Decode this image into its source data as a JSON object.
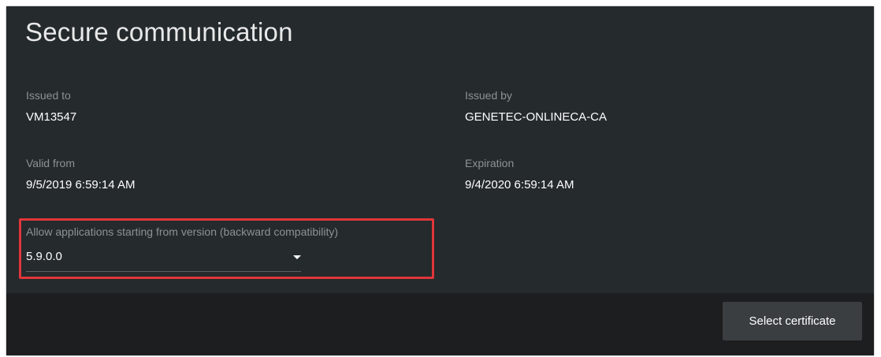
{
  "panel": {
    "title": "Secure communication"
  },
  "fields": {
    "issued_to": {
      "label": "Issued to",
      "value": "VM13547"
    },
    "issued_by": {
      "label": "Issued by",
      "value": "GENETEC-ONLINECA-CA"
    },
    "valid_from": {
      "label": "Valid from",
      "value": "9/5/2019 6:59:14 AM"
    },
    "expiration": {
      "label": "Expiration",
      "value": "9/4/2020 6:59:14 AM"
    }
  },
  "compatibility": {
    "label": "Allow applications starting from version (backward compatibility)",
    "selected": "5.9.0.0",
    "icon": "caret-down-icon"
  },
  "footer": {
    "select_certificate_label": "Select certificate"
  },
  "colors": {
    "panel_bg": "#252a2d",
    "footer_bg": "#1d1e1f",
    "label": "#8d9296",
    "value": "#ffffff",
    "highlight": "#e0363a"
  }
}
